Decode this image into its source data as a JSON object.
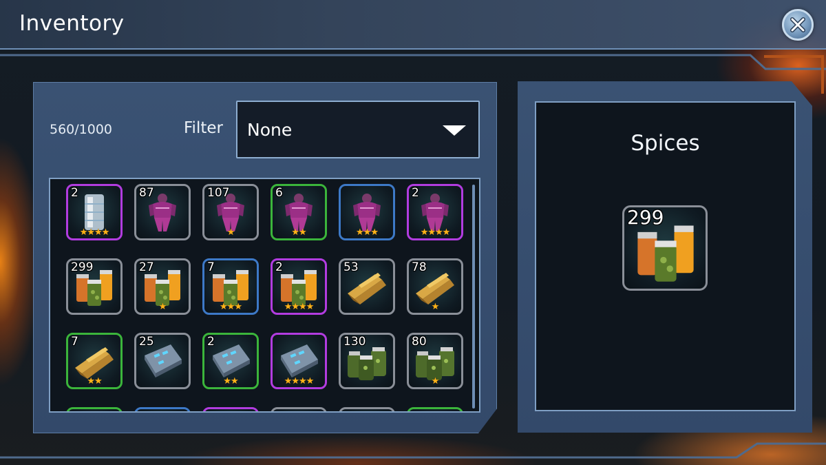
{
  "window": {
    "title": "Inventory"
  },
  "capacity": "560/1000",
  "filter": {
    "label": "Filter",
    "selected": "None"
  },
  "rarity_colors": {
    "gray": "#8a8f98",
    "green": "#3bb53b",
    "blue": "#3d79c7",
    "purple": "#b23ce0"
  },
  "items": [
    {
      "count": "2",
      "stars": "★★★★",
      "rarity": "purple",
      "icon": "crystal-pillar-icon"
    },
    {
      "count": "87",
      "stars": "",
      "rarity": "gray",
      "icon": "purple-armor-icon"
    },
    {
      "count": "107",
      "stars": "★",
      "rarity": "gray",
      "icon": "purple-armor-icon"
    },
    {
      "count": "6",
      "stars": "★★",
      "rarity": "green",
      "icon": "purple-armor-icon"
    },
    {
      "count": "",
      "stars": "★★★",
      "rarity": "blue",
      "icon": "purple-armor-icon"
    },
    {
      "count": "2",
      "stars": "★★★★",
      "rarity": "purple",
      "icon": "purple-armor-icon"
    },
    {
      "count": "299",
      "stars": "",
      "rarity": "gray",
      "icon": "spice-jars-icon"
    },
    {
      "count": "27",
      "stars": "★",
      "rarity": "gray",
      "icon": "spice-jars-icon"
    },
    {
      "count": "7",
      "stars": "★★★",
      "rarity": "blue",
      "icon": "spice-jars-icon"
    },
    {
      "count": "2",
      "stars": "★★★★",
      "rarity": "purple",
      "icon": "spice-jars-icon"
    },
    {
      "count": "53",
      "stars": "",
      "rarity": "gray",
      "icon": "wood-planks-icon"
    },
    {
      "count": "78",
      "stars": "★",
      "rarity": "gray",
      "icon": "wood-planks-icon"
    },
    {
      "count": "7",
      "stars": "★★",
      "rarity": "green",
      "icon": "wood-planks-icon"
    },
    {
      "count": "25",
      "stars": "",
      "rarity": "gray",
      "icon": "circuit-board-icon"
    },
    {
      "count": "2",
      "stars": "★★",
      "rarity": "green",
      "icon": "circuit-board-icon"
    },
    {
      "count": "",
      "stars": "★★★★",
      "rarity": "purple",
      "icon": "circuit-board-icon"
    },
    {
      "count": "130",
      "stars": "",
      "rarity": "gray",
      "icon": "herb-jars-icon"
    },
    {
      "count": "80",
      "stars": "★",
      "rarity": "gray",
      "icon": "herb-jars-icon"
    },
    {
      "count": "",
      "stars": "",
      "rarity": "green",
      "icon": ""
    },
    {
      "count": "",
      "stars": "",
      "rarity": "blue",
      "icon": ""
    },
    {
      "count": "",
      "stars": "",
      "rarity": "purple",
      "icon": ""
    },
    {
      "count": "",
      "stars": "",
      "rarity": "gray",
      "icon": ""
    },
    {
      "count": "",
      "stars": "",
      "rarity": "gray",
      "icon": ""
    },
    {
      "count": "",
      "stars": "",
      "rarity": "green",
      "icon": ""
    }
  ],
  "detail": {
    "name": "Spices",
    "count": "299",
    "icon": "spice-jars-icon"
  }
}
